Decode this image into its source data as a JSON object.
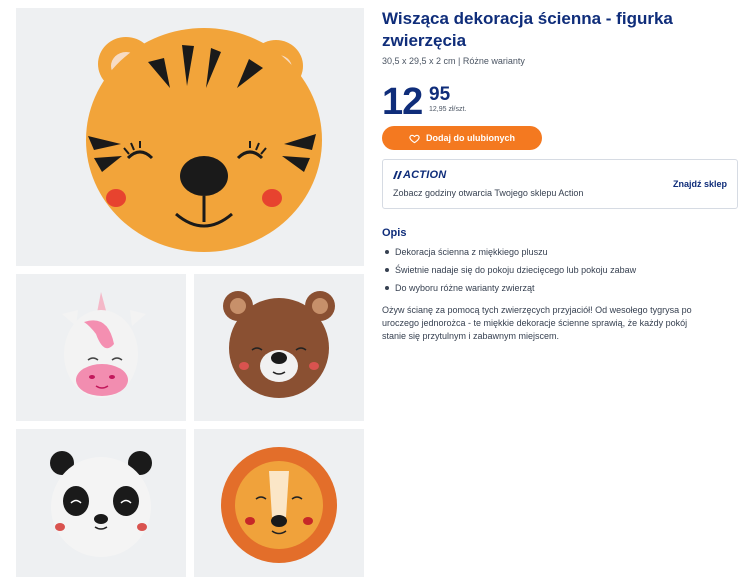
{
  "product": {
    "title": "Wisząca dekoracja ścienna - figurka zwierzęcia",
    "subtitle": "30,5 x 29,5 x 2 cm | Różne warianty",
    "price_integer": "12",
    "price_decimal": "95",
    "price_unit": "12,95 zł/szt.",
    "favorite_button_label": "Dodaj do ulubionych"
  },
  "store": {
    "brand_logo_text": "ACTION",
    "info_text": "Zobacz godziny otwarcia Twojego sklepu Action",
    "link_label": "Znajdź sklep"
  },
  "description": {
    "heading": "Opis",
    "bullets": [
      "Dekoracja ścienna z miękkiego pluszu",
      "Świetnie nadaje się do pokoju dziecięcego lub pokoju zabaw",
      "Do wyboru różne warianty zwierząt"
    ],
    "paragraph": "Ożyw ścianę za pomocą tych zwierzęcych przyjaciół! Od wesołego tygrysa po uroczego jednorożca - te miękkie dekoracje ścienne sprawią, że każdy pokój stanie się przytulnym i zabawnym miejscem."
  },
  "gallery": {
    "main": "tiger-wall-decoration",
    "thumbnails": [
      "unicorn-wall-decoration",
      "bear-wall-decoration",
      "panda-wall-decoration",
      "lion-wall-decoration"
    ]
  },
  "colors": {
    "brand_navy": "#0f2d7a",
    "accent_orange": "#f47920",
    "image_background": "#eef0f2"
  },
  "icons": {
    "favorite": "heart-icon"
  }
}
